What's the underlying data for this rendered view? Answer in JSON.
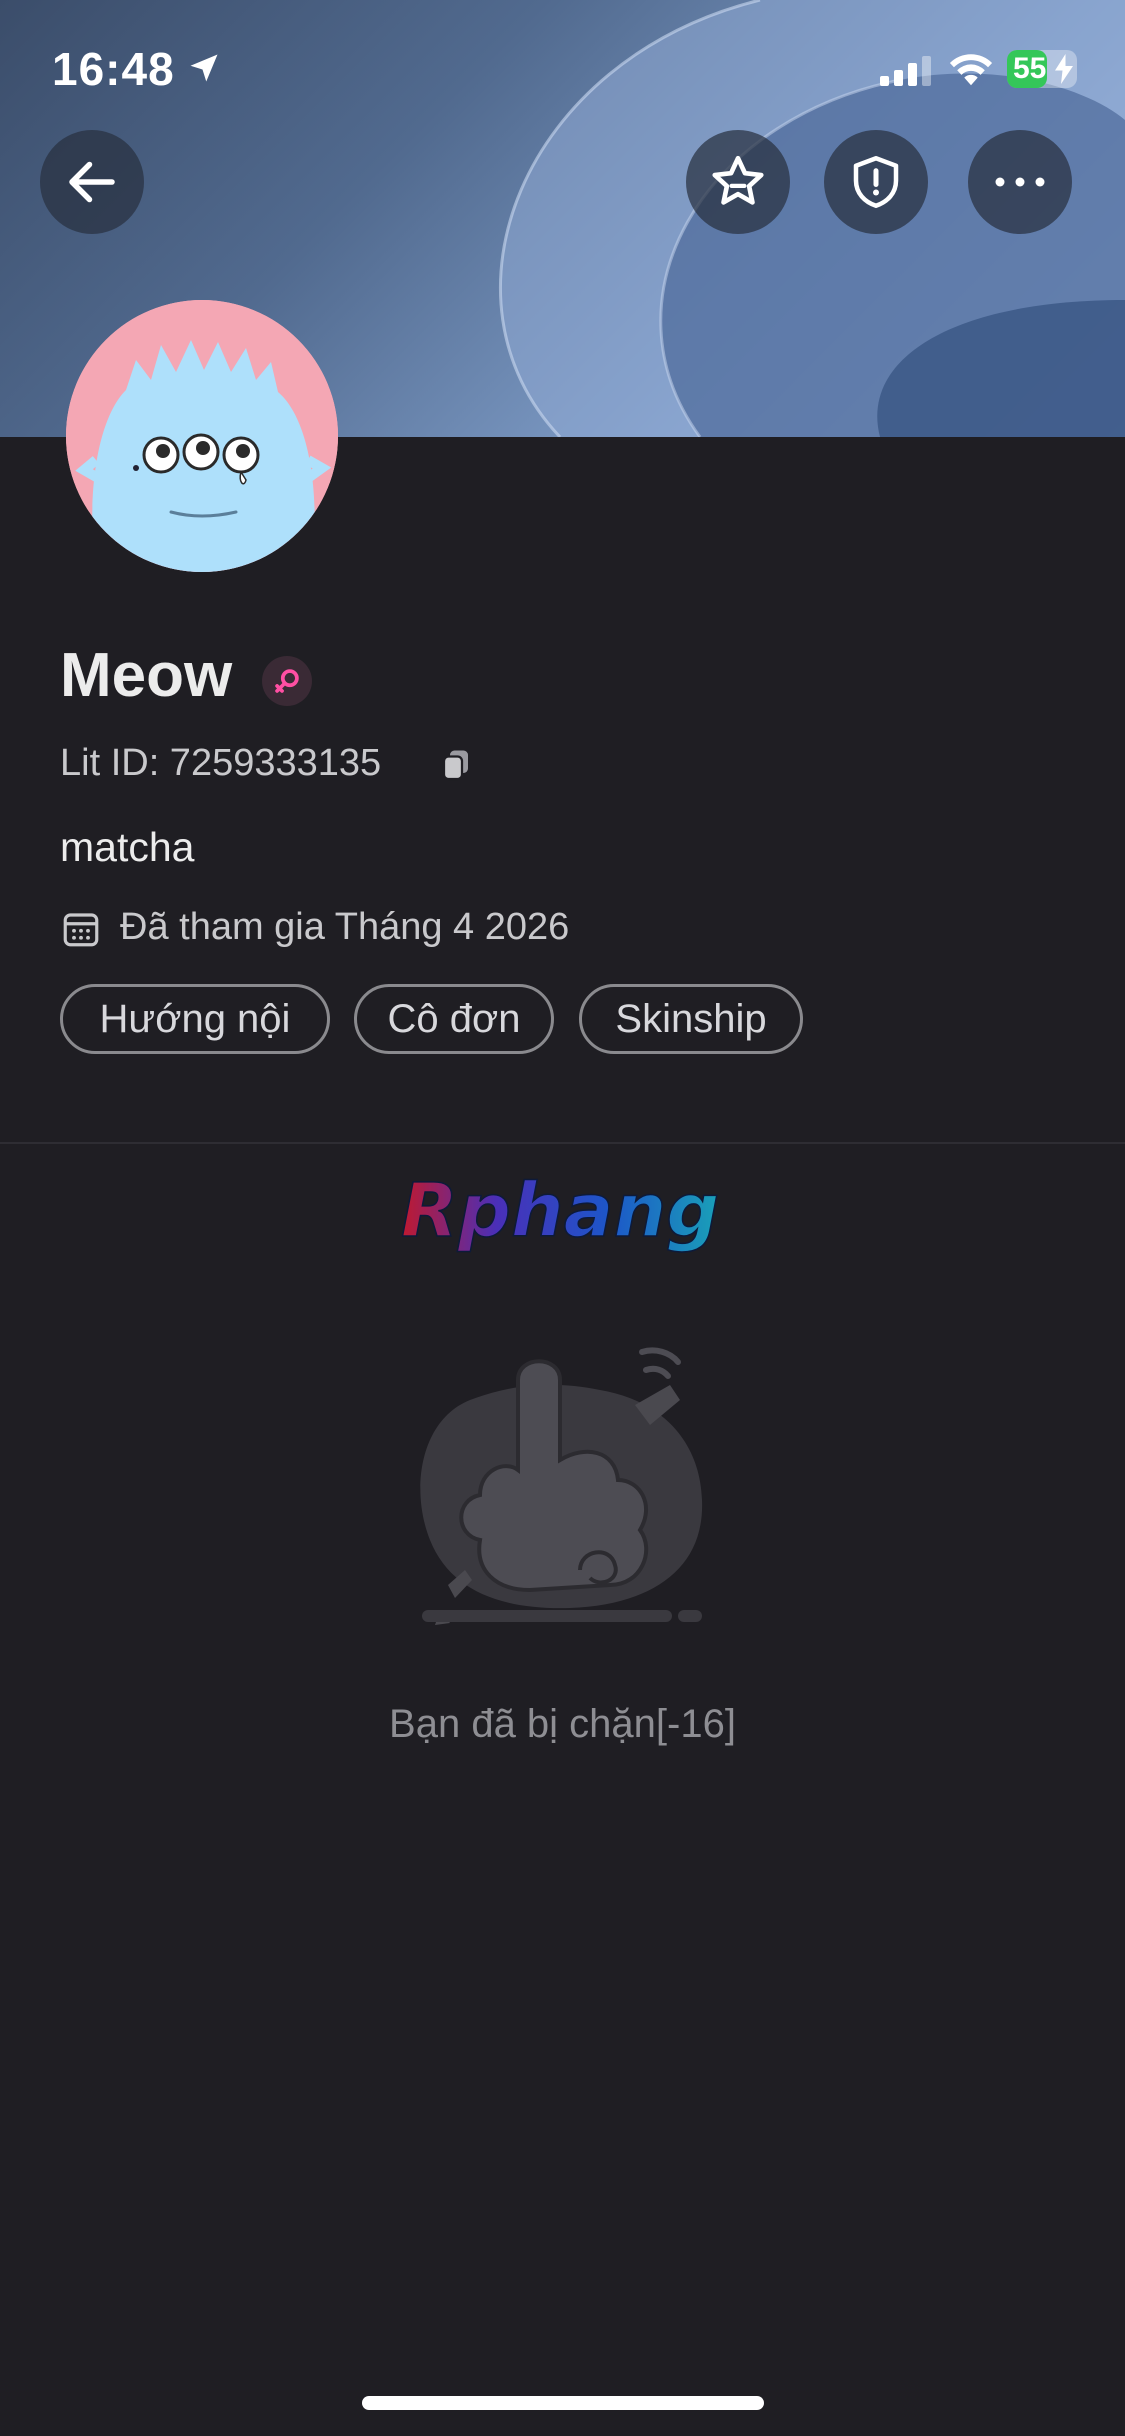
{
  "status_bar": {
    "time": "16:48",
    "battery": "55",
    "icons": [
      "location-arrow-icon",
      "signal-icon",
      "wifi-icon",
      "battery-icon"
    ]
  },
  "header": {
    "icons": [
      "back-arrow-icon",
      "star-icon",
      "shield-alert-icon",
      "more-icon"
    ]
  },
  "profile": {
    "name": "Meow",
    "lit_id": "Lit ID: 7259333135",
    "bio": "matcha",
    "joined": "Đã tham gia Tháng 4 2026",
    "gender_color": "#ff4fa3",
    "tags": [
      "Hướng nội",
      "Cô đơn",
      "Skinship"
    ]
  },
  "watermark": "Rphang",
  "blocked": {
    "message": "Bạn đã bị chặn[-16]"
  },
  "colors": {
    "background": "#1f1e23",
    "avatar_bg": "#f4a7b4",
    "avatar_face": "#aee0fb",
    "battery": "#34c759"
  }
}
